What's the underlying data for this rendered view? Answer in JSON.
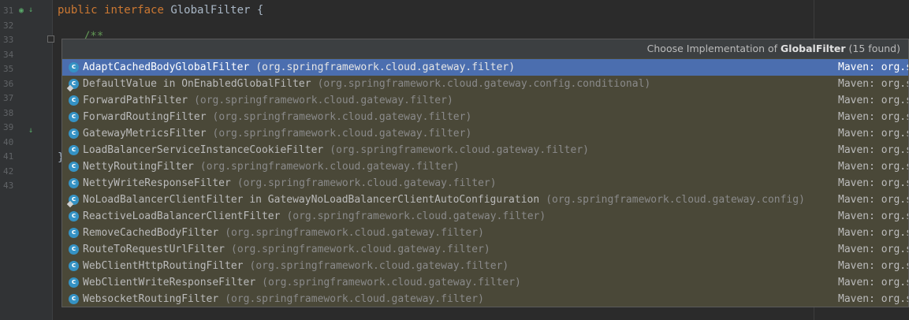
{
  "editor": {
    "line_numbers": [
      "31",
      "32",
      "33",
      "34",
      "35",
      "36",
      "37",
      "38",
      "39",
      "40",
      "41",
      "42",
      "43"
    ],
    "line31": {
      "kw1": "public",
      "kw2": "interface",
      "name": "GlobalFilter",
      "brace": "{"
    },
    "line33": "/**",
    "line42": "}"
  },
  "popup": {
    "header_prefix": "Choose Implementation of ",
    "header_bold": "GlobalFilter",
    "header_suffix": " (15 found)",
    "items": [
      {
        "name": "AdaptCachedBodyGlobalFilter",
        "package": "(org.springframework.cloud.gateway.filter)",
        "location": "Maven: org.s",
        "selected": true,
        "badge": false
      },
      {
        "name": "DefaultValue in OnEnabledGlobalFilter",
        "package": "(org.springframework.cloud.gateway.config.conditional)",
        "location": "Maven: org.s",
        "selected": false,
        "badge": true
      },
      {
        "name": "ForwardPathFilter",
        "package": "(org.springframework.cloud.gateway.filter)",
        "location": "Maven: org.s",
        "selected": false,
        "badge": false
      },
      {
        "name": "ForwardRoutingFilter",
        "package": "(org.springframework.cloud.gateway.filter)",
        "location": "Maven: org.s",
        "selected": false,
        "badge": false
      },
      {
        "name": "GatewayMetricsFilter",
        "package": "(org.springframework.cloud.gateway.filter)",
        "location": "Maven: org.s",
        "selected": false,
        "badge": false
      },
      {
        "name": "LoadBalancerServiceInstanceCookieFilter",
        "package": "(org.springframework.cloud.gateway.filter)",
        "location": "Maven: org.s",
        "selected": false,
        "badge": false
      },
      {
        "name": "NettyRoutingFilter",
        "package": "(org.springframework.cloud.gateway.filter)",
        "location": "Maven: org.s",
        "selected": false,
        "badge": false
      },
      {
        "name": "NettyWriteResponseFilter",
        "package": "(org.springframework.cloud.gateway.filter)",
        "location": "Maven: org.s",
        "selected": false,
        "badge": false
      },
      {
        "name": "NoLoadBalancerClientFilter in GatewayNoLoadBalancerClientAutoConfiguration",
        "package": "(org.springframework.cloud.gateway.config)",
        "location": "Maven: org.s",
        "selected": false,
        "badge": true
      },
      {
        "name": "ReactiveLoadBalancerClientFilter",
        "package": "(org.springframework.cloud.gateway.filter)",
        "location": "Maven: org.s",
        "selected": false,
        "badge": false
      },
      {
        "name": "RemoveCachedBodyFilter",
        "package": "(org.springframework.cloud.gateway.filter)",
        "location": "Maven: org.s",
        "selected": false,
        "badge": false
      },
      {
        "name": "RouteToRequestUrlFilter",
        "package": "(org.springframework.cloud.gateway.filter)",
        "location": "Maven: org.s",
        "selected": false,
        "badge": false
      },
      {
        "name": "WebClientHttpRoutingFilter",
        "package": "(org.springframework.cloud.gateway.filter)",
        "location": "Maven: org.s",
        "selected": false,
        "badge": false
      },
      {
        "name": "WebClientWriteResponseFilter",
        "package": "(org.springframework.cloud.gateway.filter)",
        "location": "Maven: org.s",
        "selected": false,
        "badge": false
      },
      {
        "name": "WebsocketRoutingFilter",
        "package": "(org.springframework.cloud.gateway.filter)",
        "location": "Maven: org.s",
        "selected": false,
        "badge": false
      }
    ],
    "class_icon_letter": "c"
  },
  "colors": {
    "selection": "#4b6eaf",
    "popup_bg": "#4a4838",
    "keyword": "#cc7832",
    "class_icon": "#3592c4"
  },
  "icons": {
    "implemented_marker": "implemented-gutter-icon",
    "class": "class-icon",
    "fold": "fold-marker-icon"
  }
}
